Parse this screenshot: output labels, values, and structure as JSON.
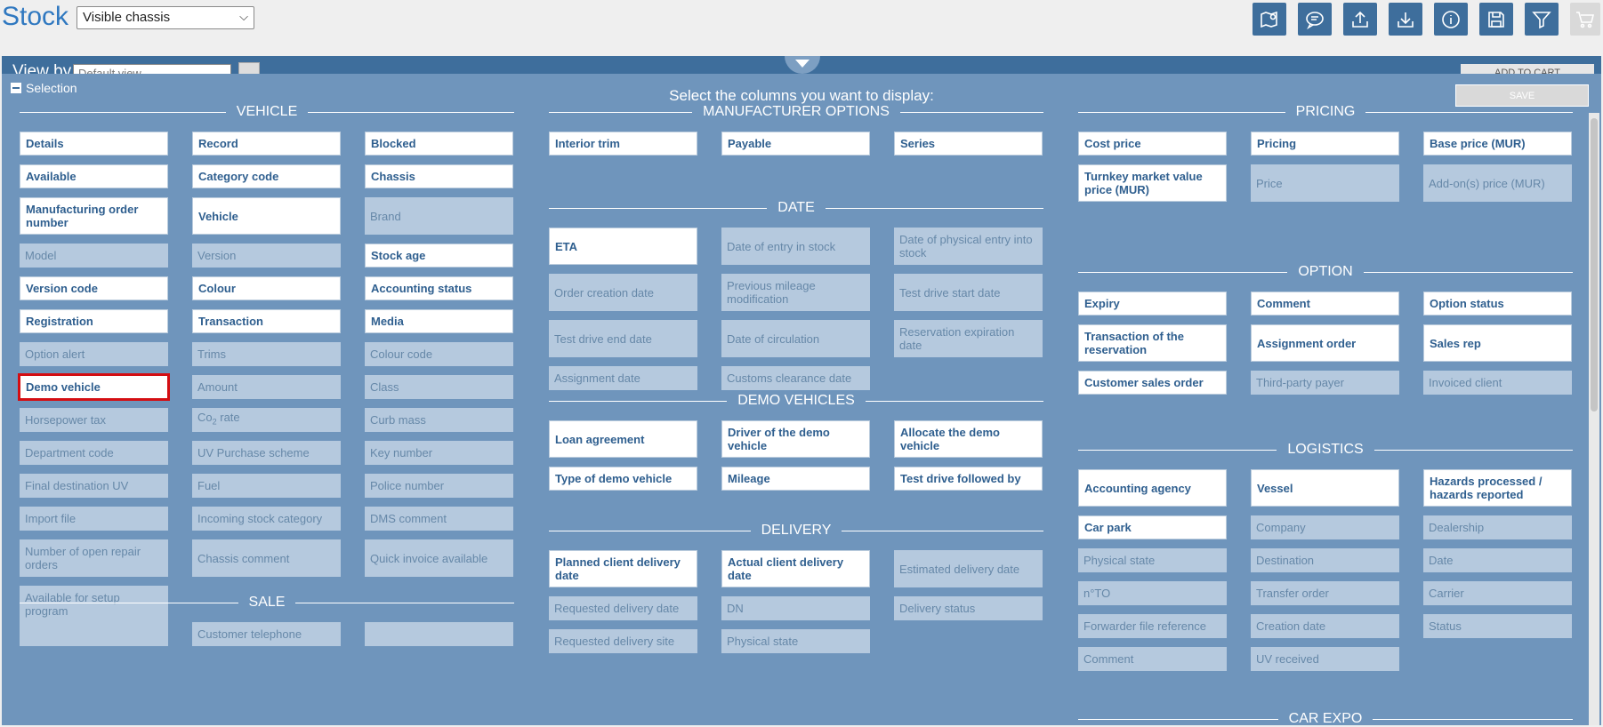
{
  "header": {
    "title": "Stock",
    "view_select": "Visible chassis",
    "toolbar_icons": [
      "map-pin-icon",
      "chat-icon",
      "upload-icon",
      "download-icon",
      "info-icon",
      "floppy-icon",
      "filter-icon",
      "cart-icon"
    ]
  },
  "underlay": {
    "view_by": "View by",
    "view_by_select": "Default view",
    "add_to_cart": "ADD TO CART"
  },
  "panel": {
    "selection": "Selection",
    "title": "Select the columns you want to display:",
    "save": "SAVE"
  },
  "columns": [
    {
      "sections": [
        {
          "title": "VEHICLE",
          "rows": [
            [
              {
                "l": "Details",
                "s": 1
              },
              {
                "l": "Record",
                "s": 1
              },
              {
                "l": "Blocked",
                "s": 1
              }
            ],
            [
              {
                "l": "Available",
                "s": 1
              },
              {
                "l": "Category code",
                "s": 1
              },
              {
                "l": "Chassis",
                "s": 1
              }
            ],
            [
              {
                "l": "Manufacturing order number",
                "s": 1
              },
              {
                "l": "Vehicle",
                "s": 1
              },
              {
                "l": "Brand",
                "s": 0
              }
            ],
            [
              {
                "l": "Model",
                "s": 0
              },
              {
                "l": "Version",
                "s": 0
              },
              {
                "l": "Stock age",
                "s": 1
              }
            ],
            [
              {
                "l": "Version code",
                "s": 1
              },
              {
                "l": "Colour",
                "s": 1
              },
              {
                "l": "Accounting status",
                "s": 1
              }
            ],
            [
              {
                "l": "Registration",
                "s": 1
              },
              {
                "l": "Transaction",
                "s": 1
              },
              {
                "l": "Media",
                "s": 1
              }
            ],
            [
              {
                "l": "Option alert",
                "s": 0
              },
              {
                "l": "Trims",
                "s": 0
              },
              {
                "l": "Colour code",
                "s": 0
              }
            ],
            [
              {
                "l": "Demo vehicle",
                "s": 1,
                "h": 1
              },
              {
                "l": "Amount",
                "s": 0
              },
              {
                "l": "Class",
                "s": 0
              }
            ],
            [
              {
                "l": "Horsepower tax",
                "s": 0
              },
              {
                "l": "Co2 rate",
                "s": 0,
                "co2": 1
              },
              {
                "l": "Curb mass",
                "s": 0
              }
            ],
            [
              {
                "l": "Department code",
                "s": 0
              },
              {
                "l": "UV Purchase scheme",
                "s": 0
              },
              {
                "l": "Key number",
                "s": 0
              }
            ],
            [
              {
                "l": "Final destination UV",
                "s": 0
              },
              {
                "l": "Fuel",
                "s": 0
              },
              {
                "l": "Police number",
                "s": 0
              }
            ],
            [
              {
                "l": "Import file",
                "s": 0
              },
              {
                "l": "Incoming stock category",
                "s": 0
              },
              {
                "l": "DMS comment",
                "s": 0
              }
            ],
            [
              {
                "l": "Number of open repair orders",
                "s": 0
              },
              {
                "l": "Chassis comment",
                "s": 0
              },
              {
                "l": "Quick invoice available",
                "s": 0
              }
            ],
            [
              {
                "l": "Available for setup program",
                "s": 0
              }
            ]
          ]
        },
        {
          "title": "SALE",
          "rows": [
            [
              {
                "l": "",
                "s": 0
              },
              {
                "l": "Customer telephone",
                "s": 0
              },
              {
                "l": "",
                "s": 0
              }
            ]
          ]
        }
      ]
    },
    {
      "sections": [
        {
          "title": "MANUFACTURER OPTIONS",
          "rows": [
            [
              {
                "l": "Interior trim",
                "s": 1
              },
              {
                "l": "Payable",
                "s": 1
              },
              {
                "l": "Series",
                "s": 1
              }
            ]
          ]
        },
        {
          "title": "DATE",
          "rows": [
            [
              {
                "l": "ETA",
                "s": 1
              },
              {
                "l": "Date of entry in stock",
                "s": 0
              },
              {
                "l": "Date of physical entry into stock",
                "s": 0
              }
            ],
            [
              {
                "l": "Order creation date",
                "s": 0
              },
              {
                "l": "Previous mileage modification",
                "s": 0
              },
              {
                "l": "Test drive start date",
                "s": 0
              }
            ],
            [
              {
                "l": "Test drive end date",
                "s": 0
              },
              {
                "l": "Date of circulation",
                "s": 0
              },
              {
                "l": "Reservation expiration date",
                "s": 0
              }
            ],
            [
              {
                "l": "Assignment date",
                "s": 0
              },
              {
                "l": "Customs clearance date",
                "s": 0
              }
            ]
          ]
        },
        {
          "title": "DEMO VEHICLES",
          "rows": [
            [
              {
                "l": "Loan agreement",
                "s": 1
              },
              {
                "l": "Driver of the demo vehicle",
                "s": 1
              },
              {
                "l": "Allocate the demo vehicle",
                "s": 1
              }
            ],
            [
              {
                "l": "Type of demo vehicle",
                "s": 1
              },
              {
                "l": "Mileage",
                "s": 1
              },
              {
                "l": "Test drive followed by",
                "s": 1
              }
            ]
          ]
        },
        {
          "title": "DELIVERY",
          "rows": [
            [
              {
                "l": "Planned client delivery date",
                "s": 1
              },
              {
                "l": "Actual client delivery date",
                "s": 1
              },
              {
                "l": "Estimated delivery date",
                "s": 0
              }
            ],
            [
              {
                "l": "Requested delivery date",
                "s": 0
              },
              {
                "l": "DN",
                "s": 0
              },
              {
                "l": "Delivery status",
                "s": 0
              }
            ],
            [
              {
                "l": "Requested delivery site",
                "s": 0
              },
              {
                "l": "Physical state",
                "s": 0
              }
            ]
          ]
        }
      ]
    },
    {
      "sections": [
        {
          "title": "PRICING",
          "rows": [
            [
              {
                "l": "Cost price",
                "s": 1
              },
              {
                "l": "Pricing",
                "s": 1
              },
              {
                "l": "Base price (MUR)",
                "s": 1
              }
            ],
            [
              {
                "l": "Turnkey market value price (MUR)",
                "s": 1
              },
              {
                "l": "Price",
                "s": 0
              },
              {
                "l": "Add-on(s) price (MUR)",
                "s": 0
              }
            ]
          ]
        },
        {
          "title": "OPTION",
          "rows": [
            [
              {
                "l": "Expiry",
                "s": 1
              },
              {
                "l": "Comment",
                "s": 1
              },
              {
                "l": "Option status",
                "s": 1
              }
            ],
            [
              {
                "l": "Transaction of the reservation",
                "s": 1
              },
              {
                "l": "Assignment order",
                "s": 1
              },
              {
                "l": "Sales rep",
                "s": 1
              }
            ],
            [
              {
                "l": "Customer sales order",
                "s": 1
              },
              {
                "l": "Third-party payer",
                "s": 0
              },
              {
                "l": "Invoiced client",
                "s": 0
              }
            ]
          ]
        },
        {
          "title": "LOGISTICS",
          "rows": [
            [
              {
                "l": "Accounting agency",
                "s": 1
              },
              {
                "l": "Vessel",
                "s": 1
              },
              {
                "l": "Hazards processed / hazards reported",
                "s": 1
              }
            ],
            [
              {
                "l": "Car park",
                "s": 1
              },
              {
                "l": "Company",
                "s": 0
              },
              {
                "l": "Dealership",
                "s": 0
              }
            ],
            [
              {
                "l": "Physical state",
                "s": 0
              },
              {
                "l": "Destination",
                "s": 0
              },
              {
                "l": "Date",
                "s": 0
              }
            ],
            [
              {
                "l": "n°TO",
                "s": 0
              },
              {
                "l": "Transfer order",
                "s": 0
              },
              {
                "l": "Carrier",
                "s": 0
              }
            ],
            [
              {
                "l": "Forwarder file reference",
                "s": 0
              },
              {
                "l": "Creation date",
                "s": 0
              },
              {
                "l": "Status",
                "s": 0
              }
            ],
            [
              {
                "l": "Comment",
                "s": 0
              },
              {
                "l": "UV received",
                "s": 0
              }
            ]
          ]
        },
        {
          "title": "CAR EXPO",
          "rows": []
        }
      ]
    }
  ]
}
